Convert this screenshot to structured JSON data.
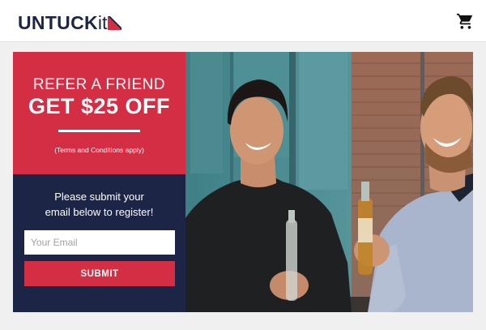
{
  "header": {
    "logo_text": "UNTUCK",
    "logo_suffix": "it",
    "cart_icon": "shopping-cart-icon"
  },
  "promo": {
    "headline": "REFER A FRIEND",
    "offer": "GET $25 OFF",
    "terms": "(Terms and Conditions apply)"
  },
  "form": {
    "prompt_line1": "Please submit your",
    "prompt_line2": "email below to register!",
    "email_placeholder": "Your Email",
    "submit_label": "SUBMIT"
  },
  "colors": {
    "brand_red": "#d42e45",
    "brand_navy": "#1d2547"
  }
}
